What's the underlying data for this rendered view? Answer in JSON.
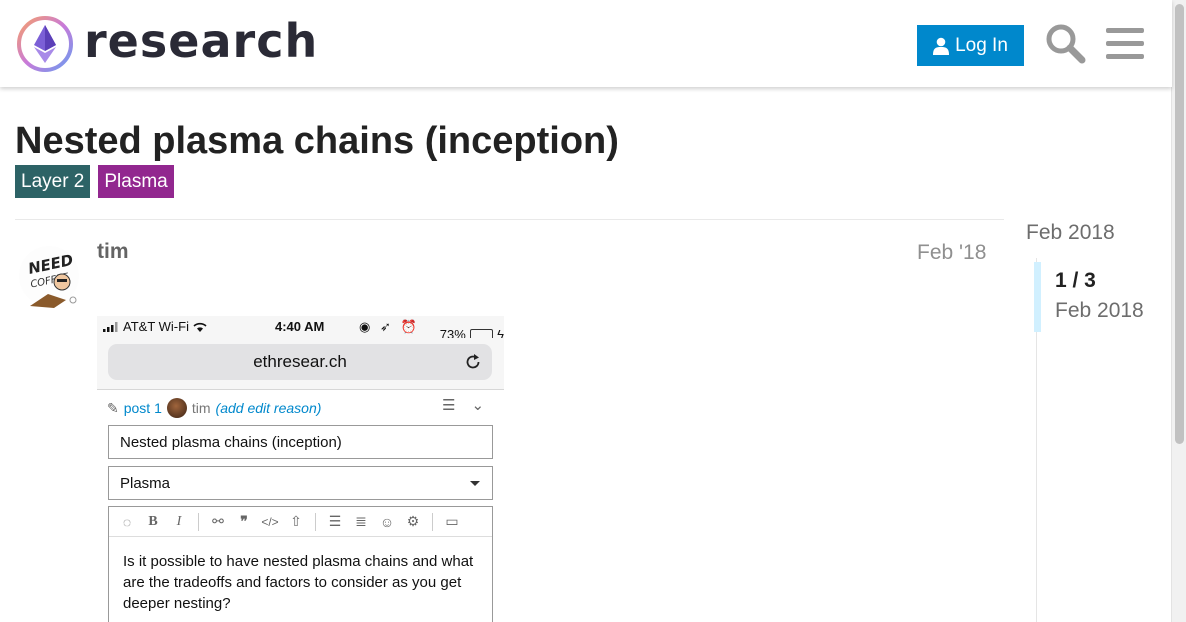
{
  "header": {
    "brand": "research",
    "login_label": "Log In"
  },
  "topic": {
    "title": "Nested plasma chains (inception)",
    "tags": [
      "Layer 2",
      "Plasma"
    ]
  },
  "colors": {
    "accent": "#0088cc",
    "tag_layer2": "#2d6366",
    "tag_plasma": "#92278f"
  },
  "post": {
    "username": "tim",
    "date": "Feb '18"
  },
  "screenshot": {
    "carrier": "AT&T Wi-Fi",
    "time": "4:40 AM",
    "battery": "73%",
    "battery_level": 0.73,
    "url": "ethresear.ch",
    "edit_post": "post 1",
    "edit_user": "tim",
    "edit_reason": "(add edit reason)",
    "title_field": "Nested plasma chains (inception)",
    "category_field": "Plasma",
    "body_text": "Is it possible to have nested plasma chains and what are the tradeoffs and factors to consider as you get deeper nesting?"
  },
  "timeline": {
    "top_date": "Feb 2018",
    "count": "1 / 3",
    "current_date": "Feb 2018"
  },
  "icons": [
    "ethereum-logo-icon",
    "user-icon",
    "search-icon",
    "hamburger-menu-icon",
    "reload-icon",
    "pencil-icon"
  ]
}
